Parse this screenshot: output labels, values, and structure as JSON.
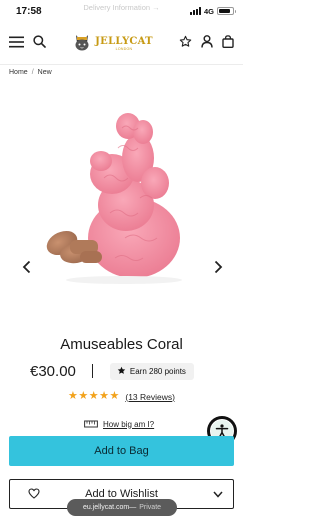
{
  "status_bar": {
    "time": "17:58",
    "network": "4G"
  },
  "banner": {
    "text": "Delivery Information →"
  },
  "header": {
    "logo_text": "JELLYCAT",
    "logo_sub": "LONDON"
  },
  "breadcrumb": {
    "home": "Home",
    "separator": "/",
    "current": "New"
  },
  "product": {
    "title": "Amuseables Coral",
    "price": "€30.00",
    "points_label": "Earn 280 points",
    "rating": 5,
    "reviews": "(13 Reviews)",
    "size_link": "How big am I?"
  },
  "actions": {
    "add_to_bag": "Add to Bag",
    "add_to_wishlist": "Add to Wishlist"
  },
  "browser": {
    "domain": "eu.jellycat.com",
    "separator": " — ",
    "mode": "Private"
  },
  "colors": {
    "accent": "#34c3dd",
    "brand_gold": "#c79a14",
    "star": "#f2a21b",
    "coral": "#f48ba0"
  },
  "icons": [
    "menu-icon",
    "search-icon",
    "star-outline-icon",
    "user-icon",
    "bag-icon",
    "chevron-left-icon",
    "chevron-right-icon",
    "star-icon",
    "ruler-icon",
    "accessibility-icon",
    "heart-icon",
    "chevron-down-icon"
  ]
}
